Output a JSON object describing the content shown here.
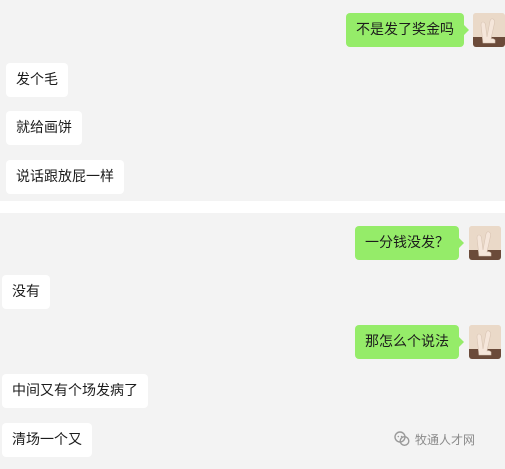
{
  "chat_top": {
    "messages": [
      {
        "side": "right",
        "text": "不是发了奖金吗"
      },
      {
        "side": "left",
        "text": "发个毛"
      },
      {
        "side": "left",
        "text": "就给画饼"
      },
      {
        "side": "left",
        "text": "说话跟放屁一样"
      }
    ]
  },
  "chat_bottom": {
    "messages": [
      {
        "side": "right",
        "text": "一分钱没发？"
      },
      {
        "side": "left",
        "text": "没有"
      },
      {
        "side": "right",
        "text": "那怎么个说法"
      },
      {
        "side": "left",
        "text": "中间又有个场发病了"
      },
      {
        "side": "left",
        "text": "清场一个又"
      }
    ]
  },
  "watermark": {
    "text": "牧通人才网",
    "icon": "wechat-official-account-icon"
  },
  "colors": {
    "outgoing_bubble": "#95ec69",
    "incoming_bubble": "#ffffff",
    "chat_background": "#f3f3f3"
  }
}
